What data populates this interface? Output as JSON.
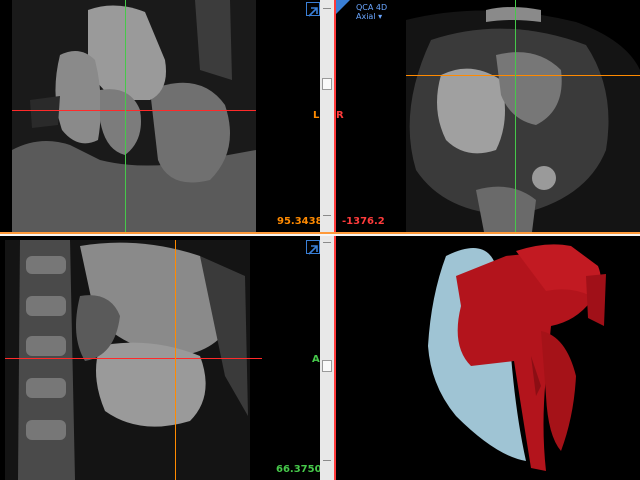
{
  "colors": {
    "axial_line": "#ff8a00",
    "coronal_line": "#ff2a2a",
    "sagittal_line": "#46c84a",
    "accent_blue": "#3a7fd6",
    "volume_red": "#b3141c",
    "volume_blue": "#9fc4d4"
  },
  "coronal_view": {
    "orientation_label": "L",
    "value_readout": "95.3438"
  },
  "axial_view": {
    "menu_label": "QCA 4D",
    "plane_label": "Axial ▾",
    "orientation_label": "R",
    "value_readout": "-1376.2"
  },
  "sagittal_view": {
    "orientation_label": "A",
    "value_readout": "66.3750"
  },
  "volume_view": {},
  "icons": [
    "expand-arrow-icon",
    "expand-arrow-icon",
    "expand-arrow-icon",
    "tab-corner-icon",
    "chevron-down-icon"
  ]
}
